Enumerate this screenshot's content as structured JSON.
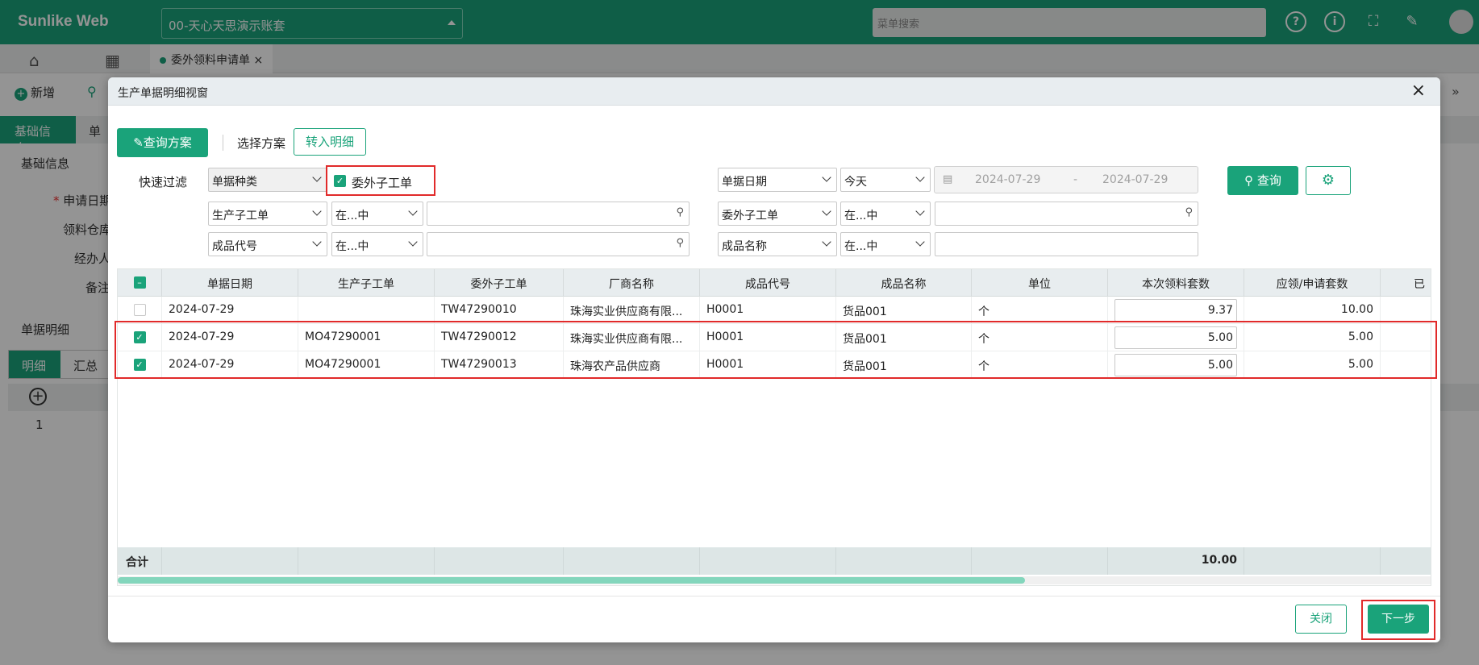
{
  "app": {
    "logo": "Sunlike Web",
    "account": "00-天心天思演示账套",
    "menu_search_placeholder": "菜单搜索",
    "doc_tab": "委外领料申请单",
    "toolbar_add": "新增",
    "tabs": [
      "基础信息",
      "单"
    ],
    "section_basic": "基础信息",
    "fields": [
      "申请日期",
      "领料仓库",
      "经办人",
      "备注"
    ],
    "section_detail": "单据明细",
    "sub_tabs": [
      "明细",
      "汇总"
    ],
    "row_no": "1"
  },
  "dialog": {
    "title": "生产单据明细视窗",
    "plan_button": "查询方案",
    "plan_label": "选择方案",
    "transfer_button": "转入明细",
    "quick_filter_label": "快速过滤",
    "filters_left": [
      {
        "field": "单据种类"
      },
      {
        "field": "生产子工单",
        "op": "在...中",
        "value": ""
      },
      {
        "field": "成品代号",
        "op": "在...中",
        "value": ""
      }
    ],
    "checkbox_label": "委外子工单",
    "filters_right": [
      {
        "field": "单据日期",
        "op": "今天"
      },
      {
        "field": "委外子工单",
        "op": "在...中",
        "value": ""
      },
      {
        "field": "成品名称",
        "op": "在...中",
        "value": ""
      }
    ],
    "date_from": "2024-07-29",
    "date_sep": "-",
    "date_to": "2024-07-29",
    "query_button": "查询",
    "grid": {
      "columns": [
        "单据日期",
        "生产子工单",
        "委外子工单",
        "厂商名称",
        "成品代号",
        "成品名称",
        "单位",
        "本次领料套数",
        "应领/申请套数",
        "已"
      ],
      "rows": [
        {
          "checked": false,
          "date": "2024-07-29",
          "mo": "",
          "tw": "TW47290010",
          "vendor": "珠海实业供应商有限...",
          "code": "H0001",
          "name": "货品001",
          "unit": "个",
          "qty": "9.37",
          "req": "10.00"
        },
        {
          "checked": true,
          "date": "2024-07-29",
          "mo": "MO47290001",
          "tw": "TW47290012",
          "vendor": "珠海实业供应商有限...",
          "code": "H0001",
          "name": "货品001",
          "unit": "个",
          "qty": "5.00",
          "req": "5.00"
        },
        {
          "checked": true,
          "date": "2024-07-29",
          "mo": "MO47290001",
          "tw": "TW47290013",
          "vendor": "珠海农产品供应商",
          "code": "H0001",
          "name": "货品001",
          "unit": "个",
          "qty": "5.00",
          "req": "5.00"
        }
      ],
      "total_label": "合计",
      "total_qty": "10.00",
      "scroll_fraction": 0.69
    },
    "close_button": "关闭",
    "next_button": "下一步"
  },
  "colors": {
    "brand": "#1aa37a",
    "highlight": "#e12a2a"
  }
}
